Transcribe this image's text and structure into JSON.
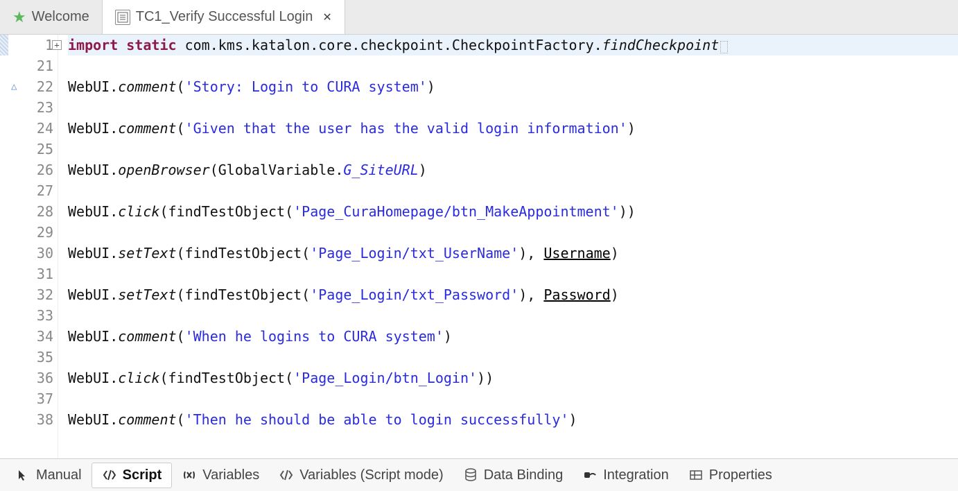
{
  "tabs": {
    "welcome": {
      "label": "Welcome"
    },
    "testcase": {
      "label": "TC1_Verify Successful Login"
    }
  },
  "code": {
    "lines": [
      {
        "num": "1",
        "fold": true,
        "hl": true,
        "tokens": [
          {
            "t": "kw",
            "v": "import"
          },
          {
            "t": "sp",
            "v": " "
          },
          {
            "t": "kw",
            "v": "static"
          },
          {
            "t": "sp",
            "v": " "
          },
          {
            "t": "pkg",
            "v": "com.kms.katalon.core.checkpoint.CheckpointFactory."
          },
          {
            "t": "method-i",
            "v": "findCheckpoint"
          },
          {
            "t": "eol",
            "v": ""
          }
        ]
      },
      {
        "num": "21",
        "tokens": []
      },
      {
        "num": "22",
        "annot": "△",
        "tokens": [
          {
            "t": "pkg",
            "v": "WebUI."
          },
          {
            "t": "method-i",
            "v": "comment"
          },
          {
            "t": "pkg",
            "v": "("
          },
          {
            "t": "str",
            "v": "'Story: Login to CURA system'"
          },
          {
            "t": "pkg",
            "v": ")"
          }
        ]
      },
      {
        "num": "23",
        "tokens": []
      },
      {
        "num": "24",
        "tokens": [
          {
            "t": "pkg",
            "v": "WebUI."
          },
          {
            "t": "method-i",
            "v": "comment"
          },
          {
            "t": "pkg",
            "v": "("
          },
          {
            "t": "str",
            "v": "'Given that the user has the valid login information'"
          },
          {
            "t": "pkg",
            "v": ")"
          }
        ]
      },
      {
        "num": "25",
        "tokens": []
      },
      {
        "num": "26",
        "tokens": [
          {
            "t": "pkg",
            "v": "WebUI."
          },
          {
            "t": "method-i",
            "v": "openBrowser"
          },
          {
            "t": "pkg",
            "v": "(GlobalVariable."
          },
          {
            "t": "glb",
            "v": "G_SiteURL"
          },
          {
            "t": "pkg",
            "v": ")"
          }
        ]
      },
      {
        "num": "27",
        "tokens": []
      },
      {
        "num": "28",
        "tokens": [
          {
            "t": "pkg",
            "v": "WebUI."
          },
          {
            "t": "method-i",
            "v": "click"
          },
          {
            "t": "pkg",
            "v": "(findTestObject("
          },
          {
            "t": "str",
            "v": "'Page_CuraHomepage/btn_MakeAppointment'"
          },
          {
            "t": "pkg",
            "v": "))"
          }
        ]
      },
      {
        "num": "29",
        "tokens": []
      },
      {
        "num": "30",
        "tokens": [
          {
            "t": "pkg",
            "v": "WebUI."
          },
          {
            "t": "method-i",
            "v": "setText"
          },
          {
            "t": "pkg",
            "v": "(findTestObject("
          },
          {
            "t": "str",
            "v": "'Page_Login/txt_UserName'"
          },
          {
            "t": "pkg",
            "v": "), "
          },
          {
            "t": "under",
            "v": "Username"
          },
          {
            "t": "pkg",
            "v": ")"
          }
        ]
      },
      {
        "num": "31",
        "tokens": []
      },
      {
        "num": "32",
        "tokens": [
          {
            "t": "pkg",
            "v": "WebUI."
          },
          {
            "t": "method-i",
            "v": "setText"
          },
          {
            "t": "pkg",
            "v": "(findTestObject("
          },
          {
            "t": "str",
            "v": "'Page_Login/txt_Password'"
          },
          {
            "t": "pkg",
            "v": "), "
          },
          {
            "t": "under",
            "v": "Password"
          },
          {
            "t": "pkg",
            "v": ")"
          }
        ]
      },
      {
        "num": "33",
        "tokens": []
      },
      {
        "num": "34",
        "tokens": [
          {
            "t": "pkg",
            "v": "WebUI."
          },
          {
            "t": "method-i",
            "v": "comment"
          },
          {
            "t": "pkg",
            "v": "("
          },
          {
            "t": "str",
            "v": "'When he logins to CURA system'"
          },
          {
            "t": "pkg",
            "v": ")"
          }
        ]
      },
      {
        "num": "35",
        "tokens": []
      },
      {
        "num": "36",
        "tokens": [
          {
            "t": "pkg",
            "v": "WebUI."
          },
          {
            "t": "method-i",
            "v": "click"
          },
          {
            "t": "pkg",
            "v": "(findTestObject("
          },
          {
            "t": "str",
            "v": "'Page_Login/btn_Login'"
          },
          {
            "t": "pkg",
            "v": "))"
          }
        ]
      },
      {
        "num": "37",
        "tokens": []
      },
      {
        "num": "38",
        "tokens": [
          {
            "t": "pkg",
            "v": "WebUI."
          },
          {
            "t": "method-i",
            "v": "comment"
          },
          {
            "t": "pkg",
            "v": "("
          },
          {
            "t": "str",
            "v": "'Then he should be able to login successfully'"
          },
          {
            "t": "pkg",
            "v": ")"
          }
        ]
      }
    ]
  },
  "bottomTabs": {
    "manual": "Manual",
    "script": "Script",
    "variables": "Variables",
    "variablesScript": "Variables (Script mode)",
    "dataBinding": "Data Binding",
    "integration": "Integration",
    "properties": "Properties"
  }
}
